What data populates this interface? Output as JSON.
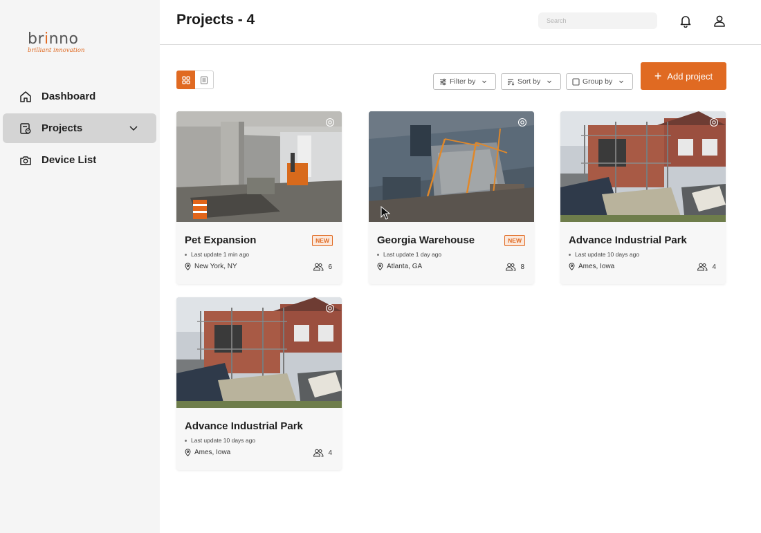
{
  "brand": {
    "logo_text_a": "br",
    "logo_text_b": "i",
    "logo_text_c": "nno",
    "tagline": "brilliant innovation",
    "accent": "#e06a22"
  },
  "sidebar": {
    "items": [
      {
        "label": "Dashboard",
        "icon": "home-icon",
        "active": false
      },
      {
        "label": "Projects",
        "icon": "projects-icon",
        "active": true
      },
      {
        "label": "Device List",
        "icon": "camera-icon",
        "active": false
      }
    ]
  },
  "header": {
    "title": "Projects - 4",
    "search_placeholder": "Search"
  },
  "toolbar": {
    "filter_label": "Filter by",
    "sort_label": "Sort by",
    "group_label": "Group by",
    "add_label": "Add project"
  },
  "projects": [
    {
      "name": "Pet Expansion",
      "badge": "NEW",
      "updated": "Last update 1 min ago",
      "location": "New York, NY",
      "members": "6"
    },
    {
      "name": "Georgia Warehouse",
      "badge": "NEW",
      "updated": "Last update 1 day ago",
      "location": "Atlanta, GA",
      "members": "8"
    },
    {
      "name": "Advance Industrial Park",
      "badge": "",
      "updated": "Last update 10 days ago",
      "location": "Ames, Iowa",
      "members": "4"
    },
    {
      "name": "Advance Industrial Park",
      "badge": "",
      "updated": "Last update 10 days ago",
      "location": "Ames, Iowa",
      "members": "4"
    }
  ]
}
